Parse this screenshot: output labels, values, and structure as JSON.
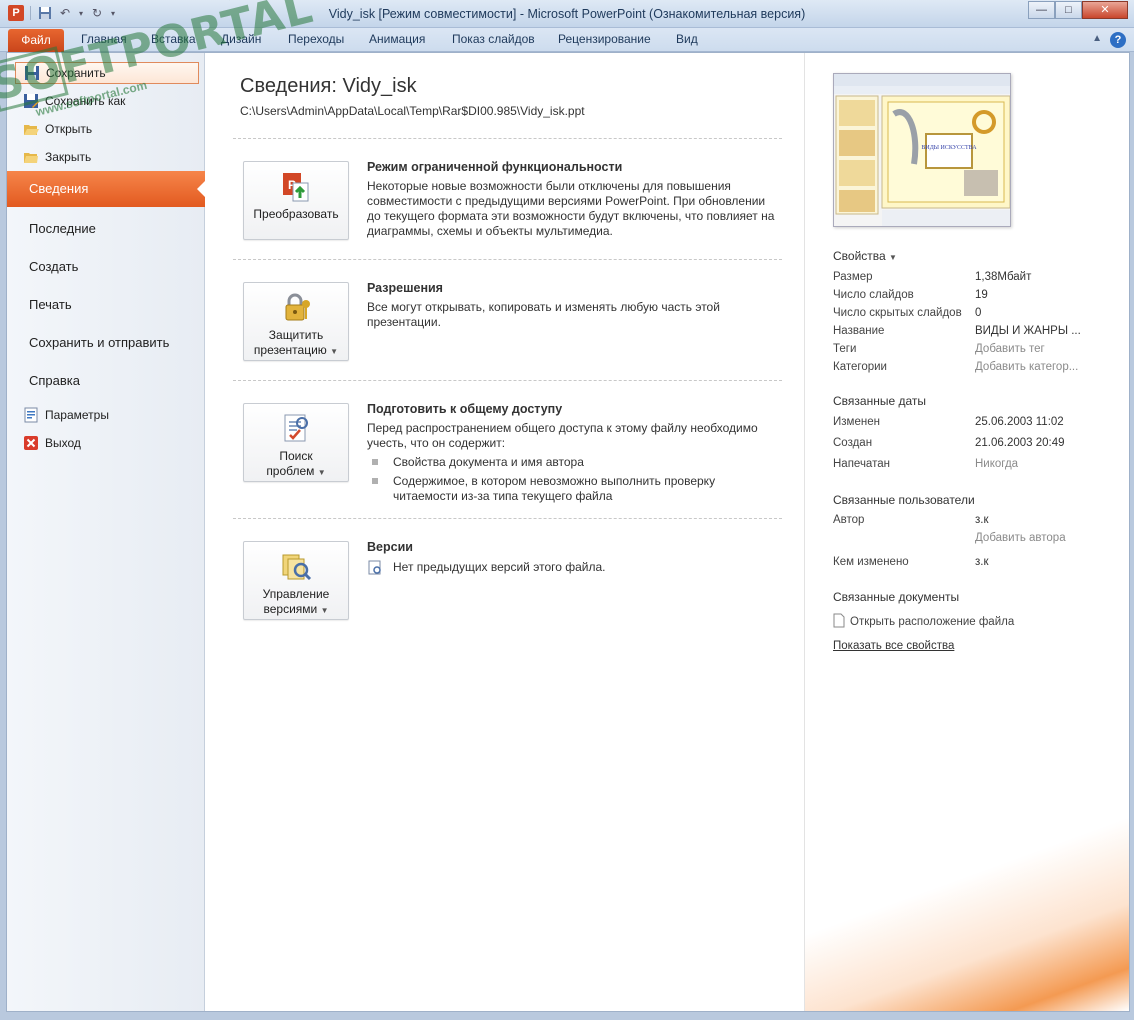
{
  "window": {
    "title": "Vidy_isk [Режим совместимости]  -  Microsoft PowerPoint (Ознакомительная версия)",
    "app_icon_letter": "P",
    "controls": {
      "minimize": "—",
      "maximize": "□",
      "close": "✕"
    }
  },
  "ribbon": {
    "file_tab": "Файл",
    "tabs": [
      "Главная",
      "Вставка",
      "Дизайн",
      "Переходы",
      "Анимация",
      "Показ слайдов",
      "Рецензирование",
      "Вид"
    ],
    "help": "?"
  },
  "watermark": {
    "text": "SOFTPORTAL",
    "url": "www.softportal.com",
    "tm": "TM"
  },
  "nav": {
    "small_items": [
      {
        "label": "Сохранить",
        "icon": "save-icon"
      },
      {
        "label": "Сохранить как",
        "icon": "save-as-icon"
      },
      {
        "label": "Открыть",
        "icon": "open-icon"
      },
      {
        "label": "Закрыть",
        "icon": "close-folder-icon"
      }
    ],
    "selected": "Сведения",
    "big_items": [
      "Последние",
      "Создать",
      "Печать",
      "Сохранить и отправить",
      "Справка"
    ],
    "bottom_items": [
      {
        "label": "Параметры",
        "icon": "options-icon"
      },
      {
        "label": "Выход",
        "icon": "exit-icon"
      }
    ]
  },
  "info": {
    "title": "Сведения: Vidy_isk",
    "path": "C:\\Users\\Admin\\AppData\\Local\\Temp\\Rar$DI00.985\\Vidy_isk.ppt",
    "sections": [
      {
        "button": "Преобразовать",
        "heading": "Режим ограниченной функциональности",
        "text": "Некоторые новые возможности были отключены для повышения совместимости с предыдущими версиями PowerPoint. При обновлении до текущего формата эти возможности будут включены, что повлияет на диаграммы, схемы и объекты мультимедиа."
      },
      {
        "button_line1": "Защитить",
        "button_line2": "презентацию",
        "heading": "Разрешения",
        "text": "Все могут открывать, копировать и изменять любую часть этой презентации."
      },
      {
        "button_line1": "Поиск",
        "button_line2": "проблем",
        "heading": "Подготовить к общему доступу",
        "text": "Перед распространением общего доступа к этому файлу необходимо учесть, что он содержит:",
        "bullets": [
          "Свойства документа и имя автора",
          "Содержимое, в котором невозможно выполнить проверку читаемости из-за типа текущего файла"
        ]
      },
      {
        "button_line1": "Управление",
        "button_line2": "версиями",
        "heading": "Версии",
        "text": "Нет предыдущих версий этого файла."
      }
    ]
  },
  "properties": {
    "heading": "Свойства",
    "rows": [
      {
        "key": "Размер",
        "value": "1,38Мбайт"
      },
      {
        "key": "Число слайдов",
        "value": "19"
      },
      {
        "key": "Число скрытых слайдов",
        "value": "0"
      },
      {
        "key": "Название",
        "value": "ВИДЫ  И  ЖАНРЫ ..."
      },
      {
        "key": "Теги",
        "value": "Добавить тег"
      },
      {
        "key": "Категории",
        "value": "Добавить категор..."
      }
    ],
    "dates_heading": "Связанные даты",
    "dates": [
      {
        "key": "Изменен",
        "value": "25.06.2003 11:02"
      },
      {
        "key": "Создан",
        "value": "21.06.2003 20:49"
      },
      {
        "key": "Напечатан",
        "value": "Никогда"
      }
    ],
    "people_heading": "Связанные пользователи",
    "author_key": "Автор",
    "author_value": "з.к",
    "add_author": "Добавить автора",
    "modified_by_key": "Кем изменено",
    "modified_by_value": "з.к",
    "docs_heading": "Связанные документы",
    "open_location": "Открыть расположение файла",
    "show_all": "Показать все свойства",
    "thumbnail_text": "ВИДЫ ИСКУССТВА"
  }
}
